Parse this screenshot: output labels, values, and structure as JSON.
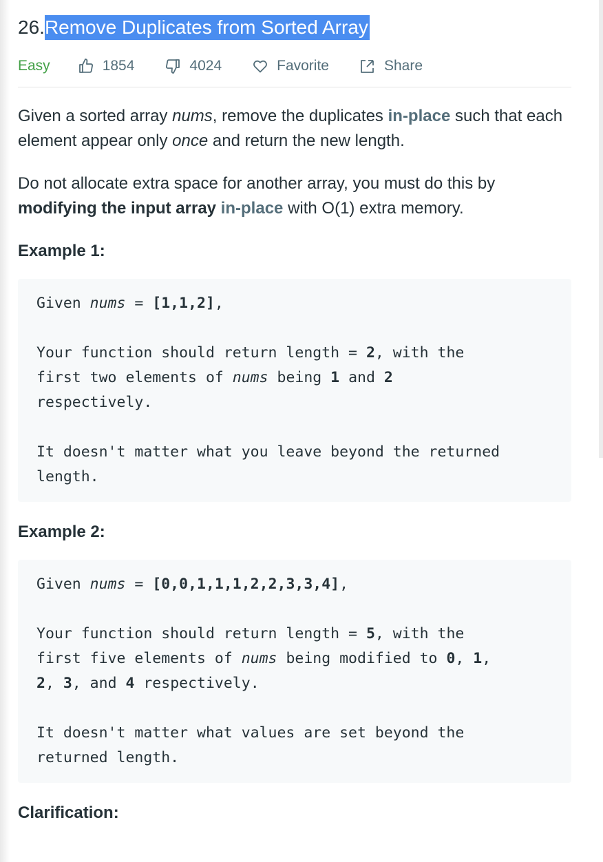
{
  "problem": {
    "number": "26.",
    "title": "Remove Duplicates from Sorted Array",
    "difficulty": "Easy",
    "likes": "1854",
    "dislikes": "4024",
    "favorite_label": "Favorite",
    "share_label": "Share"
  },
  "description": {
    "p1": {
      "t1": "Given a sorted array ",
      "nums": "nums",
      "t2": ", remove the duplicates ",
      "inplace": "in-place",
      "t3": " such that each element appear only ",
      "once": "once",
      "t4": " and return the new length."
    },
    "p2": {
      "t1": "Do not allocate extra space for another array, you must do this by ",
      "bold": "modifying the input array",
      "t2": " ",
      "inplace": "in-place",
      "t3": " with O(1) extra memory."
    }
  },
  "example1": {
    "heading": "Example 1:",
    "l1a": "Given ",
    "l1b": "nums",
    "l1c": " = ",
    "l1d": "[1,1,2]",
    "l1e": ",",
    "l2a": "Your function should return length = ",
    "l2b": "2",
    "l2c": ", with the",
    "l3a": "first two elements of ",
    "l3b": "nums",
    "l3c": " being ",
    "l3d": "1",
    "l3e": " and ",
    "l3f": "2",
    "l4": "respectively.",
    "l5": "It doesn't matter what you leave beyond the returned",
    "l6": "length."
  },
  "example2": {
    "heading": "Example 2:",
    "l1a": "Given ",
    "l1b": "nums",
    "l1c": " = ",
    "l1d": "[0,0,1,1,1,2,2,3,3,4]",
    "l1e": ",",
    "l2a": "Your function should return length = ",
    "l2b": "5",
    "l2c": ", with the",
    "l3a": "first five elements of ",
    "l3b": "nums",
    "l3c": " being modified to ",
    "l3d": "0",
    "l3e": ", ",
    "l3f": "1",
    "l3g": ",",
    "l4a": "2",
    "l4b": ", ",
    "l4c": "3",
    "l4d": ", and ",
    "l4e": "4",
    "l4f": " respectively.",
    "l5": "It doesn't matter what values are set beyond the",
    "l6": "returned length."
  },
  "clarification": {
    "heading": "Clarification:"
  },
  "colors": {
    "selection": "#4a8df0",
    "easy": "#43a047",
    "muted": "#546e7a",
    "code_bg": "#f7f9fa"
  },
  "icons": [
    "thumbs-up-icon",
    "thumbs-down-icon",
    "heart-icon",
    "share-icon"
  ]
}
